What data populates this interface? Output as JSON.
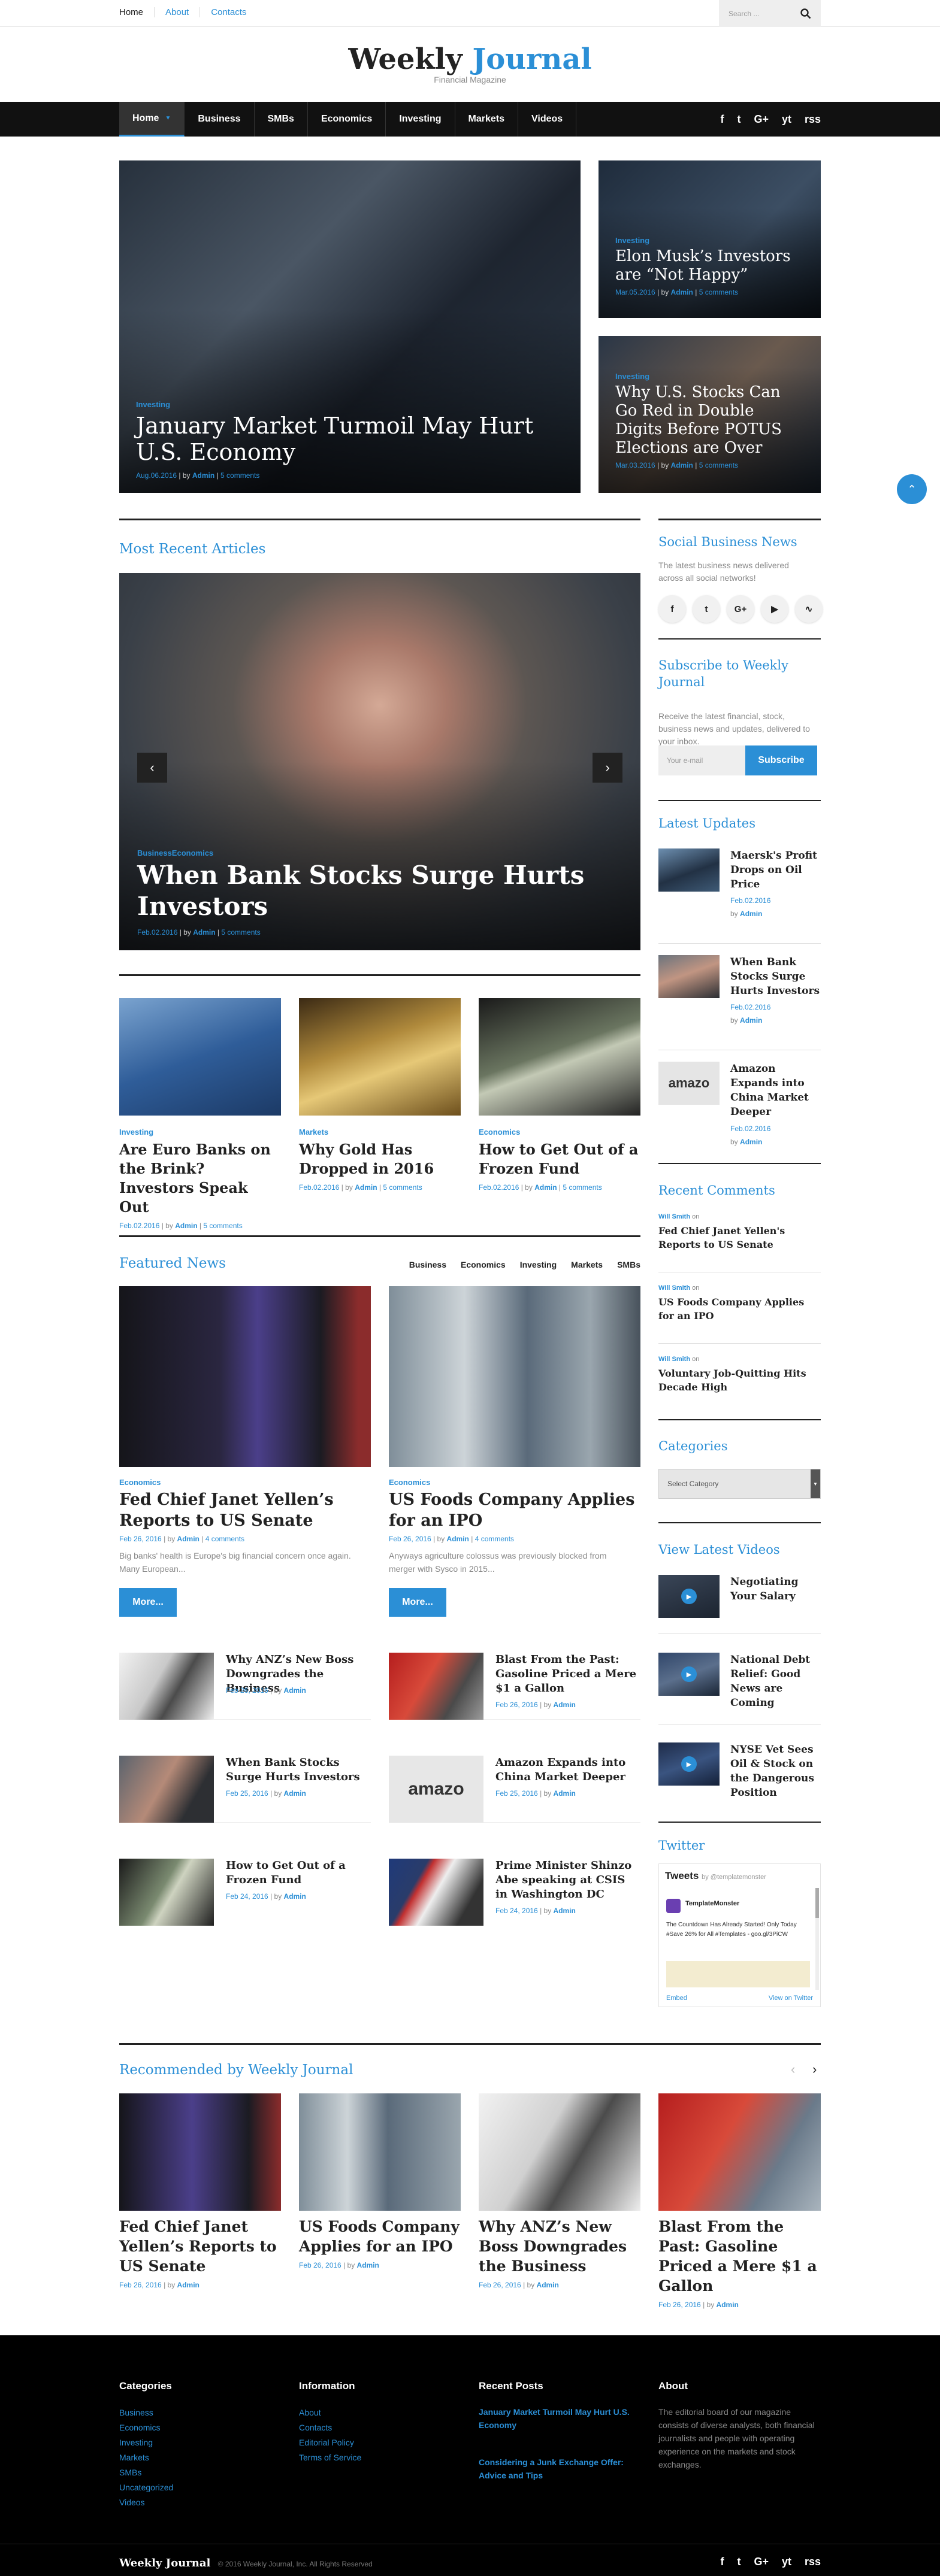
{
  "topbar": {
    "links": [
      "Home",
      "About",
      "Contacts"
    ],
    "search_placeholder": "Search ..."
  },
  "logo": {
    "name_part1": "Weekly",
    "name_part2": "Journal",
    "tagline": "Financial Magazine"
  },
  "nav": {
    "items": [
      "Home",
      "Business",
      "SMBs",
      "Economics",
      "Investing",
      "Markets",
      "Videos"
    ],
    "social": [
      "f",
      "t",
      "G+",
      "yt",
      "rss"
    ]
  },
  "hero": {
    "main": {
      "category": "Investing",
      "title": "January Market Turmoil May Hurt U.S. Economy",
      "date": "Aug.06.2016",
      "author": "Admin",
      "comments": "5 comments"
    },
    "side1": {
      "category": "Investing",
      "title": "Elon Musk’s Investors are “Not Happy”",
      "date": "Mar.05.2016",
      "author": "Admin",
      "comments": "5 comments"
    },
    "side2": {
      "category": "Investing",
      "title": "Why U.S. Stocks Can Go Red in Double Digits Before POTUS Elections are Over",
      "date": "Mar.03.2016",
      "author": "Admin",
      "comments": "5 comments"
    }
  },
  "recent": {
    "heading": "Most Recent Articles",
    "slide": {
      "category": "BusinessEconomics",
      "title": "When Bank Stocks Surge Hurts Investors",
      "date": "Feb.02.2016",
      "author": "Admin",
      "comments": "5 comments"
    },
    "cards": [
      {
        "category": "Investing",
        "title": "Are Euro Banks on the Brink? Investors Speak Out",
        "date": "Feb.02.2016",
        "author": "Admin",
        "comments": "5 comments"
      },
      {
        "category": "Markets",
        "title": "Why Gold Has Dropped in 2016",
        "date": "Feb.02.2016",
        "author": "Admin",
        "comments": "5 comments"
      },
      {
        "category": "Economics",
        "title": "How to Get Out of a Frozen Fund",
        "date": "Feb.02.2016",
        "author": "Admin",
        "comments": "5 comments"
      }
    ]
  },
  "featured": {
    "heading": "Featured News",
    "tabs": [
      "Business",
      "Economics",
      "Investing",
      "Markets",
      "SMBs"
    ],
    "main": [
      {
        "category": "Economics",
        "title": "Fed Chief Janet Yellen’s Reports to US Senate",
        "date": "Feb 26, 2016",
        "author": "Admin",
        "comments": "4 comments",
        "excerpt": "Big banks' health is Europe's big financial concern once again. Many European...",
        "more": "More..."
      },
      {
        "category": "Economics",
        "title": "US Foods Company Applies for an IPO",
        "date": "Feb 26, 2016",
        "author": "Admin",
        "comments": "4 comments",
        "excerpt": "Anyways agriculture colossus was previously blocked from merger with Sysco in 2015...",
        "more": "More..."
      }
    ],
    "list": [
      {
        "title": "Why ANZ’s New Boss Downgrades the Business",
        "date": "Feb 26, 2016",
        "author": "Admin"
      },
      {
        "title": "Blast From the Past: Gasoline Priced a Mere $1 a Gallon",
        "date": "Feb 26, 2016",
        "author": "Admin"
      },
      {
        "title": "When Bank Stocks Surge Hurts Investors",
        "date": "Feb 25, 2016",
        "author": "Admin"
      },
      {
        "title": "Amazon Expands into China Market Deeper",
        "date": "Feb 25, 2016",
        "author": "Admin"
      },
      {
        "title": "How to Get Out of a Frozen Fund",
        "date": "Feb 24, 2016",
        "author": "Admin"
      },
      {
        "title": "Prime Minister Shinzo Abe speaking at CSIS in Washington DC",
        "date": "Feb 24, 2016",
        "author": "Admin"
      }
    ]
  },
  "sidebar": {
    "social_heading": "Social Business News",
    "social_text": "The latest business news delivered across all social networks!",
    "subscribe_heading": "Subscribe to Weekly Journal",
    "subscribe_text": "Receive the latest financial, stock, business news and updates, delivered to your inbox.",
    "email_placeholder": "Your e-mail",
    "subscribe_button": "Subscribe",
    "latest_heading": "Latest Updates",
    "latest": [
      {
        "title": "Maersk's Profit Drops on Oil Price",
        "date": "Feb.02.2016",
        "author": "Admin"
      },
      {
        "title": "When Bank Stocks Surge Hurts Investors",
        "date": "Feb.02.2016",
        "author": "Admin"
      },
      {
        "title": "Amazon Expands into China Market Deeper",
        "date": "Feb.02.2016",
        "author": "Admin"
      }
    ],
    "comments_heading": "Recent Comments",
    "comments": [
      {
        "who": "Will Smith",
        "on": "on",
        "title": "Fed Chief Janet Yellen's Reports to US Senate"
      },
      {
        "who": "Will Smith",
        "on": "on",
        "title": "US Foods Company Applies for an IPO"
      },
      {
        "who": "Will Smith",
        "on": "on",
        "title": "Voluntary Job-Quitting Hits Decade High"
      }
    ],
    "categories_heading": "Categories",
    "categories_select": "Select Category",
    "videos_heading": "View Latest Videos",
    "videos": [
      "Negotiating Your Salary",
      "National Debt Relief: Good News are Coming",
      "NYSE Vet Sees Oil & Stock on the Dangerous Position"
    ],
    "twitter_heading": "Twitter",
    "tweets_label": "Tweets",
    "tweets_by": "by @templatemonster",
    "tweet_user": "TemplateMonster",
    "tweet_text": "The Countdown Has Already Started! Only Today #Save 26% for All #Templates - goo.gl/3PiCW",
    "embed": "Embed",
    "view_on_twitter": "View on Twitter"
  },
  "recommended": {
    "heading": "Recommended by Weekly Journal",
    "items": [
      {
        "title": "Fed Chief Janet Yellen’s Reports to US Senate",
        "date": "Feb 26, 2016",
        "author": "Admin"
      },
      {
        "title": "US Foods Company Applies for an IPO",
        "date": "Feb 26, 2016",
        "author": "Admin"
      },
      {
        "title": "Why ANZ’s New Boss Downgrades the Business",
        "date": "Feb 26, 2016",
        "author": "Admin"
      },
      {
        "title": "Blast From the Past: Gasoline Priced a Mere $1 a Gallon",
        "date": "Feb 26, 2016",
        "author": "Admin"
      }
    ]
  },
  "footer": {
    "categories_heading": "Categories",
    "categories": [
      "Business",
      "Economics",
      "Investing",
      "Markets",
      "SMBs",
      "Uncategorized",
      "Videos"
    ],
    "info_heading": "Information",
    "info": [
      "About",
      "Contacts",
      "Editorial Policy",
      "Terms of Service"
    ],
    "posts_heading": "Recent Posts",
    "posts": [
      "January Market Turmoil May Hurt U.S. Economy",
      "Considering a Junk Exchange Offer: Advice and Tips"
    ],
    "about_heading": "About",
    "about_text": "The editorial board of our magazine consists of diverse analysts, both financial journalists and people with operating experience on the markets and stock exchanges.",
    "brand": "Weekly Journal",
    "copyright": "© 2016 Weekly Journal, Inc. All Rights Reserved"
  },
  "colors": {
    "accent": "#2b8fd6",
    "nav": "#111111",
    "footer": "#000000"
  }
}
